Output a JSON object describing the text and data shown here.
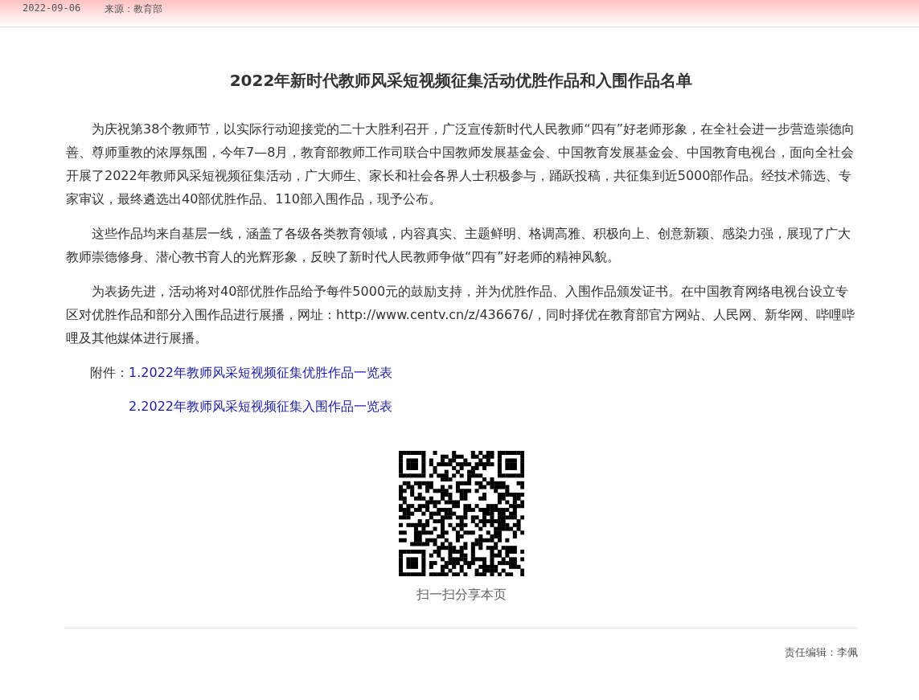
{
  "header": {
    "date": "2022-09-06",
    "source": "来源：教育部"
  },
  "title": "2022年新时代教师风采短视频征集活动优胜作品和入围作品名单",
  "paragraphs": [
    "为庆祝第38个教师节，以实际行动迎接党的二十大胜利召开，广泛宣传新时代人民教师“四有”好老师形象，在全社会进一步营造崇德向善、尊师重教的浓厚氛围，今年7—8月，教育部教师工作司联合中国教师发展基金会、中国教育发展基金会、中国教育电视台，面向全社会开展了2022年教师风采短视频征集活动，广大师生、家长和社会各界人士积极参与，踊跃投稿，共征集到近5000部作品。经技术筛选、专家审议，最终遴选出40部优胜作品、110部入围作品，现予公布。",
    "这些作品均来自基层一线，涵盖了各级各类教育领域，内容真实、主题鲜明、格调高雅、积极向上、创意新颖、感染力强，展现了广大教师崇德修身、潜心教书育人的光辉形象，反映了新时代人民教师争做“四有”好老师的精神风貌。",
    "为表扬先进，活动将对40部优胜作品给予每件5000元的鼓励支持，并为优胜作品、入围作品颁发证书。在中国教育网络电视台设立专区对优胜作品和部分入围作品进行展播，网址：http://www.centv.cn/z/436676/，同时择优在教育部官方网站、人民网、新华网、哔哩哔哩及其他媒体进行展播。"
  ],
  "attachments": {
    "label": "附件：",
    "items": [
      "1.2022年教师风采短视频征集优胜作品一览表",
      "2.2022年教师风采短视频征集入围作品一览表"
    ]
  },
  "qr": {
    "caption": "扫一扫分享本页"
  },
  "editor": "责任编辑：李佩"
}
